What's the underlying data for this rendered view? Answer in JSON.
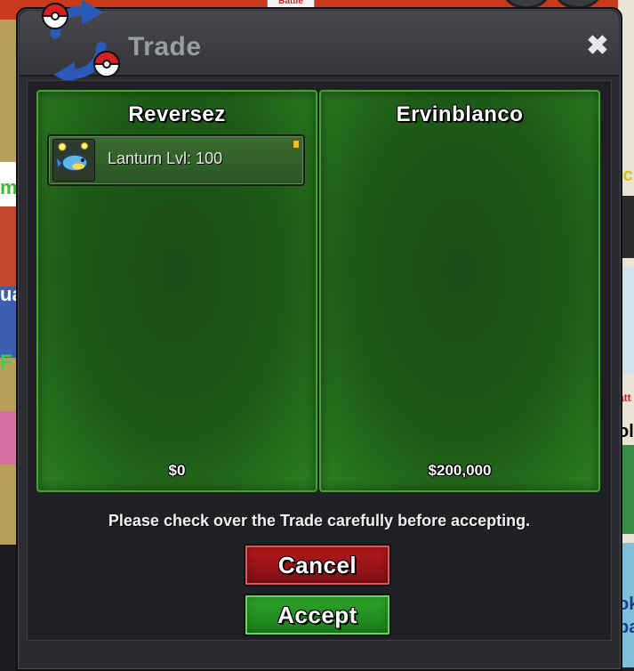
{
  "background": {
    "top_button_label": "Battle",
    "left_fragments": [
      "mv",
      "ua",
      "F"
    ],
    "right_fragments": [
      "ic",
      "att",
      "ol",
      "ok",
      "pa"
    ]
  },
  "window": {
    "title": "Trade",
    "close_glyph": "✖",
    "logo_icon": "trade-arrows-pokeball-icon"
  },
  "trade": {
    "left": {
      "name": "Reversez",
      "items": [
        {
          "label": "Lanturn  Lvl: 100",
          "icon": "lanturn-icon"
        }
      ],
      "money": "$0"
    },
    "right": {
      "name": "Ervinblanco",
      "items": [],
      "money": "$200,000"
    }
  },
  "notice": "Please check over the Trade carefully before accepting.",
  "buttons": {
    "cancel": "Cancel",
    "accept": "Accept"
  },
  "colors": {
    "panel_green": "#2d7f21",
    "cancel_red": "#b6181c",
    "accept_green": "#2ea62a"
  }
}
